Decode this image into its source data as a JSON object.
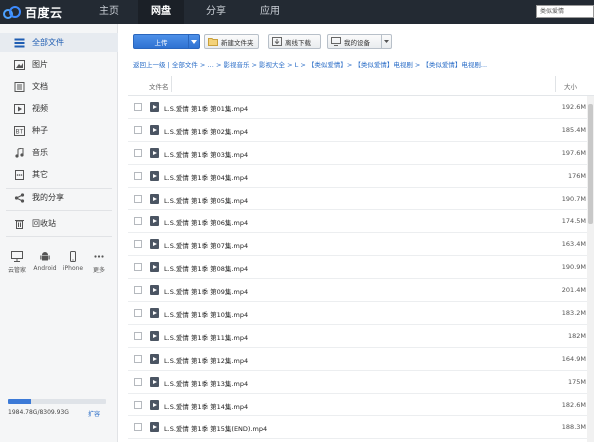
{
  "brand": {
    "name": "百度云"
  },
  "nav": {
    "tabs": [
      "主页",
      "网盘",
      "分享",
      "应用"
    ],
    "active": 1
  },
  "search": {
    "value": "类似爱情"
  },
  "sidebar": {
    "items": [
      {
        "label": "全部文件",
        "icon": "folder-stack-icon"
      },
      {
        "label": "图片",
        "icon": "image-icon"
      },
      {
        "label": "文档",
        "icon": "document-icon"
      },
      {
        "label": "视频",
        "icon": "video-icon"
      },
      {
        "label": "种子",
        "icon": "bt-icon"
      },
      {
        "label": "音乐",
        "icon": "music-icon"
      },
      {
        "label": "其它",
        "icon": "other-icon"
      },
      {
        "label": "我的分享",
        "icon": "share-icon"
      },
      {
        "label": "回收站",
        "icon": "trash-icon"
      }
    ],
    "devices": [
      "云管家",
      "Android",
      "iPhone",
      "更多"
    ],
    "quota": {
      "text": "1984.78G/8309.93G",
      "link": "扩容",
      "used_fraction": 0.239
    }
  },
  "toolbar": {
    "upload": "上传",
    "new_folder": "新建文件夹",
    "offline": "离线下载",
    "devices": "我的设备"
  },
  "breadcrumb": "返回上一级 | 全部文件 > … > 影视音乐 > 影视大全 > L > 【类似爱情】> 【类似爱情】电视剧 > 【类似爱情】电视剧...",
  "table": {
    "headers": {
      "name": "文件名",
      "size": "大小"
    },
    "rows": [
      {
        "name": "L.S.爱情 第1季 第01集.mp4",
        "size": "192.6M"
      },
      {
        "name": "L.S.爱情 第1季 第02集.mp4",
        "size": "185.4M"
      },
      {
        "name": "L.S.爱情 第1季 第03集.mp4",
        "size": "197.6M"
      },
      {
        "name": "L.S.爱情 第1季 第04集.mp4",
        "size": "176M"
      },
      {
        "name": "L.S.爱情 第1季 第05集.mp4",
        "size": "190.7M"
      },
      {
        "name": "L.S.爱情 第1季 第06集.mp4",
        "size": "174.5M"
      },
      {
        "name": "L.S.爱情 第1季 第07集.mp4",
        "size": "163.4M"
      },
      {
        "name": "L.S.爱情 第1季 第08集.mp4",
        "size": "190.9M"
      },
      {
        "name": "L.S.爱情 第1季 第09集.mp4",
        "size": "201.4M"
      },
      {
        "name": "L.S.爱情 第1季 第10集.mp4",
        "size": "183.2M"
      },
      {
        "name": "L.S.爱情 第1季 第11集.mp4",
        "size": "182M"
      },
      {
        "name": "L.S.爱情 第1季 第12集.mp4",
        "size": "164.9M"
      },
      {
        "name": "L.S.爱情 第1季 第13集.mp4",
        "size": "175M"
      },
      {
        "name": "L.S.爱情 第1季 第14集.mp4",
        "size": "182.6M"
      },
      {
        "name": "L.S.爱情 第1季 第15集(END).mp4",
        "size": "188.3M"
      }
    ]
  },
  "colors": {
    "topbar": "#232a33",
    "accent": "#2f72d2",
    "link": "#2a6dc7"
  }
}
